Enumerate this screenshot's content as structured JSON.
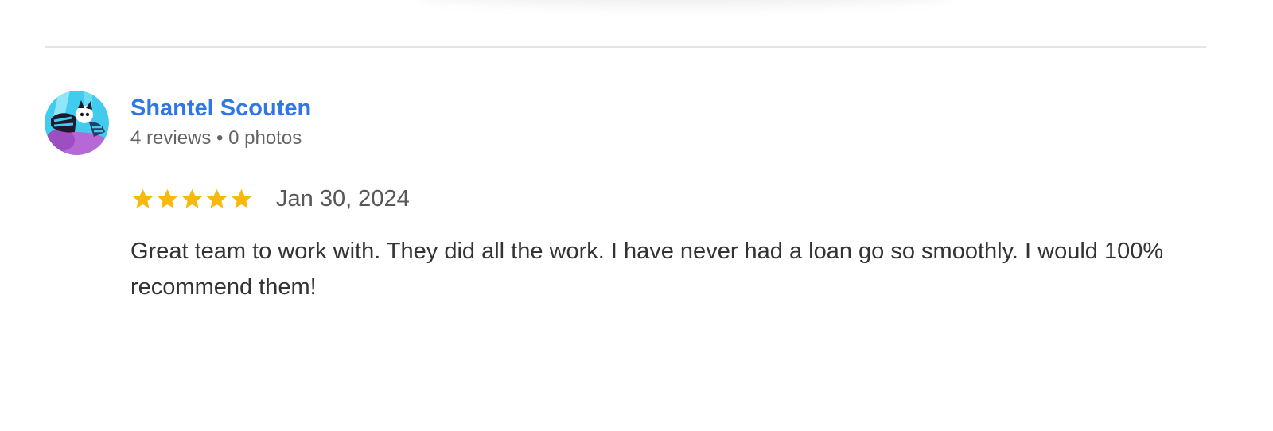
{
  "review": {
    "author": {
      "name": "Shantel Scouten",
      "reviews_count": "4 reviews",
      "separator": "•",
      "photos_count": "0 photos",
      "avatar_icon": "cartoon-avatar-icon"
    },
    "rating": {
      "value": 5,
      "max": 5,
      "star_icon": "star-icon",
      "star_color": "#f9b90c"
    },
    "date": "Jan 30, 2024",
    "text": "Great team to work with. They did all the work. I have never had a loan go so smoothly. I would 100% recommend them!"
  },
  "colors": {
    "author_link": "#2f77e6",
    "meta_text": "#646464",
    "body_text": "#333333",
    "divider": "#e4e4e4"
  }
}
